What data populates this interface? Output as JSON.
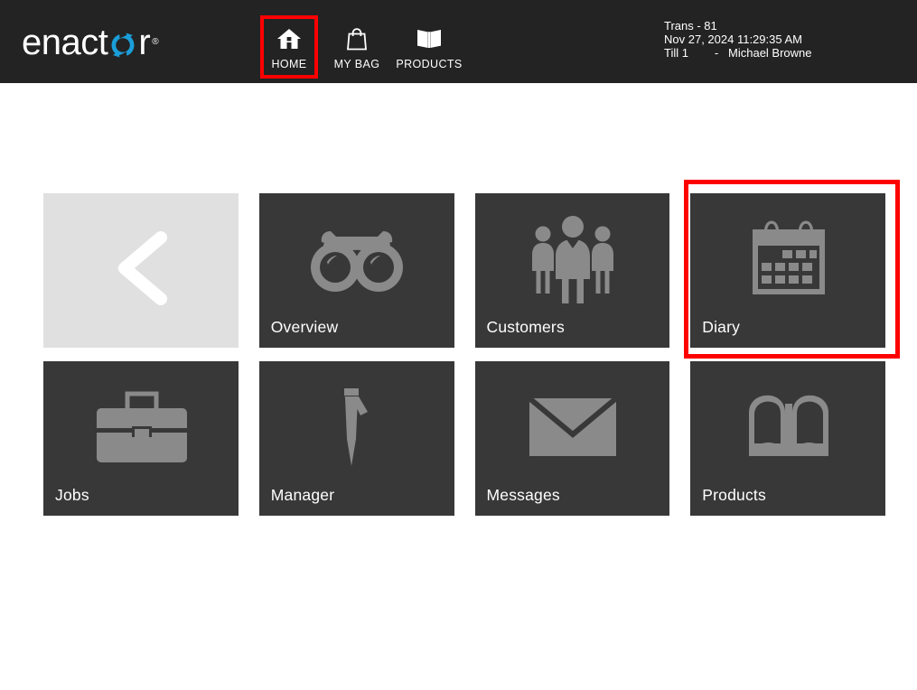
{
  "header": {
    "logo": {
      "text_before": "enact",
      "text_after": "r",
      "trademark": "®",
      "icon_name": "circular-arrow-icon",
      "accent_color": "#1a9ed9",
      "background": "#232323"
    },
    "nav": [
      {
        "id": "home",
        "label": "HOME",
        "icon": "home-icon",
        "highlighted": true
      },
      {
        "id": "my-bag",
        "label": "MY BAG",
        "icon": "shopping-bag-icon",
        "highlighted": false
      },
      {
        "id": "products",
        "label": "PRODUCTS",
        "icon": "open-book-icon",
        "highlighted": false
      }
    ],
    "transaction": {
      "line1": "Trans - 81",
      "line2": "Nov 27, 2024 11:29:35 AM",
      "line3": "Till 1        -   Michael Browne"
    }
  },
  "main": {
    "rows": [
      [
        {
          "id": "back",
          "label": "",
          "icon": "chevron-left-icon",
          "style": "back",
          "highlighted": false
        },
        {
          "id": "overview",
          "label": "Overview",
          "icon": "binoculars-icon",
          "style": "dark",
          "highlighted": false
        },
        {
          "id": "customers",
          "label": "Customers",
          "icon": "people-group-icon",
          "style": "dark",
          "highlighted": false
        },
        {
          "id": "diary",
          "label": "Diary",
          "icon": "calendar-icon",
          "style": "dark",
          "highlighted": true
        }
      ],
      [
        {
          "id": "jobs",
          "label": "Jobs",
          "icon": "briefcase-icon",
          "style": "dark",
          "highlighted": false
        },
        {
          "id": "manager",
          "label": "Manager",
          "icon": "necktie-icon",
          "style": "dark",
          "highlighted": false
        },
        {
          "id": "messages",
          "label": "Messages",
          "icon": "envelope-icon",
          "style": "dark",
          "highlighted": false
        },
        {
          "id": "products",
          "label": "Products",
          "icon": "open-book-icon",
          "style": "dark",
          "highlighted": false
        }
      ]
    ]
  },
  "annotations": {
    "color": "#ff0000",
    "targets": [
      "home",
      "diary"
    ]
  },
  "theme": {
    "tile_dark": "#383838",
    "tile_back": "#e0e0e0",
    "icon_gray": "#8a8a8a",
    "page_background": "#ffffff"
  }
}
